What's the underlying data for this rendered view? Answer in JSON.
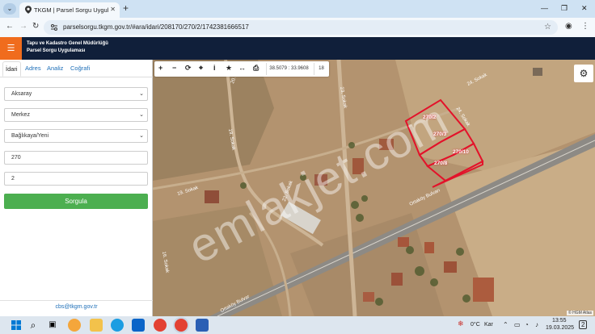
{
  "browser": {
    "tab_title": "TKGM | Parsel Sorgu Uygulaması",
    "close_glyph": "✕",
    "new_tab_glyph": "+",
    "url": "parselsorgu.tkgm.gov.tr/#ara/idari/208170/270/2/1742381666517"
  },
  "app": {
    "org_name": "Tapu ve Kadastro Genel Müdürlüğü",
    "app_name": "Parsel Sorgu Uygulaması"
  },
  "panel": {
    "tabs": [
      "İdari",
      "Adres",
      "Analiz",
      "Coğrafi"
    ],
    "il": "Aksaray",
    "ilce": "Merkez",
    "mahalle": "Bağlıkaya/Yeni",
    "ada": "270",
    "parsel": "2",
    "query_button": "Sorgula",
    "footer_email": "cbs@tkgm.gov.tr"
  },
  "map": {
    "coordinates": "38.5079 : 33.9608",
    "zoom": "18",
    "attribution": "© HGM Atlas",
    "watermark": "emlakjet.com",
    "street_labels": [
      "20. Sokak",
      "23. Sokak",
      "24. Sokak",
      "24. Sokak",
      "19. Sokak",
      "19. Sokak",
      "22. Sokak",
      "Ortaköy Bulvarı",
      "Ortaköy Bulvar",
      "16. Sokak"
    ],
    "parcels": [
      "270/2",
      "270/3",
      "270/10",
      "270/8"
    ],
    "accent_color": "#e3122a"
  },
  "taskbar": {
    "weather": "0°C",
    "weather_desc": "Kar",
    "time": "13:55",
    "date": "19.03.2025",
    "notifications": "2"
  }
}
